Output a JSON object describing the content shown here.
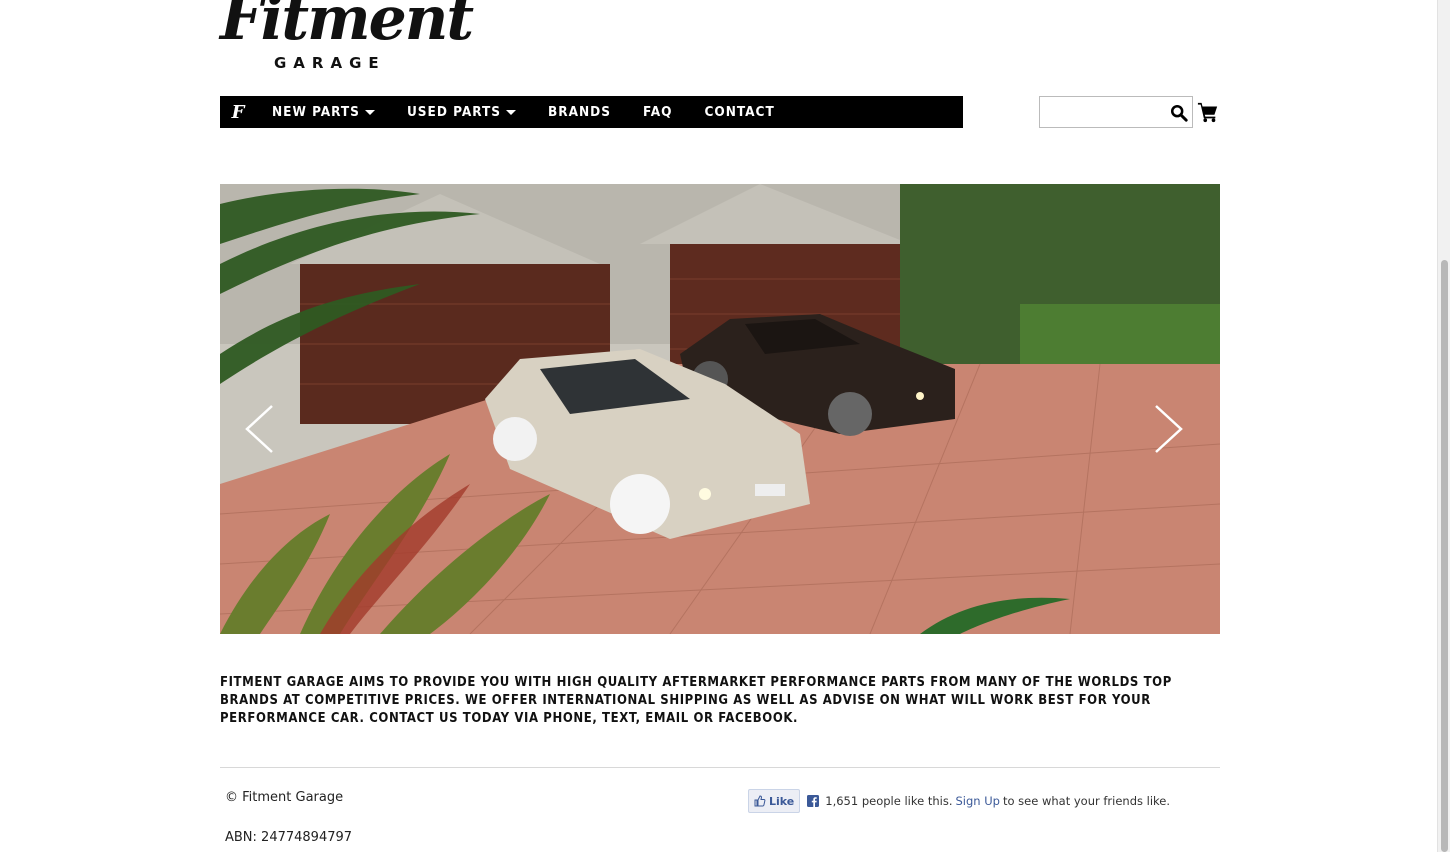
{
  "logo": {
    "script": "Fitment",
    "sub": "GARAGE"
  },
  "nav": {
    "items": [
      {
        "label": "NEW PARTS",
        "dropdown": true
      },
      {
        "label": "USED PARTS",
        "dropdown": true
      },
      {
        "label": "BRANDS",
        "dropdown": false
      },
      {
        "label": "FAQ",
        "dropdown": false
      },
      {
        "label": "CONTACT",
        "dropdown": false
      }
    ],
    "home_glyph": "F"
  },
  "search": {
    "value": "",
    "placeholder": ""
  },
  "hero": {
    "alt": "Two sedans parked on a tiled driveway"
  },
  "intro": "FITMENT GARAGE AIMS TO PROVIDE YOU WITH HIGH QUALITY AFTERMARKET PERFORMANCE PARTS FROM MANY OF THE WORLDS TOP BRANDS AT COMPETITIVE PRICES. WE OFFER INTERNATIONAL SHIPPING AS WELL AS ADVISE ON WHAT WILL WORK BEST FOR YOUR PERFORMANCE CAR. CONTACT US TODAY VIA PHONE, TEXT, EMAIL OR FACEBOOK.",
  "footer": {
    "copyright": "© Fitment Garage",
    "abn": "ABN: 24774894797"
  },
  "facebook": {
    "like_label": "Like",
    "count_text": "1,651 people like this.",
    "signup_label": "Sign Up",
    "suffix": "to see what your friends like."
  },
  "colors": {
    "nav_bg": "#000000",
    "fb_blue": "#3b5998"
  },
  "icons": [
    "search-icon",
    "cart-icon",
    "chevron-left-icon",
    "chevron-right-icon",
    "facebook-icon",
    "thumbs-up-icon"
  ]
}
